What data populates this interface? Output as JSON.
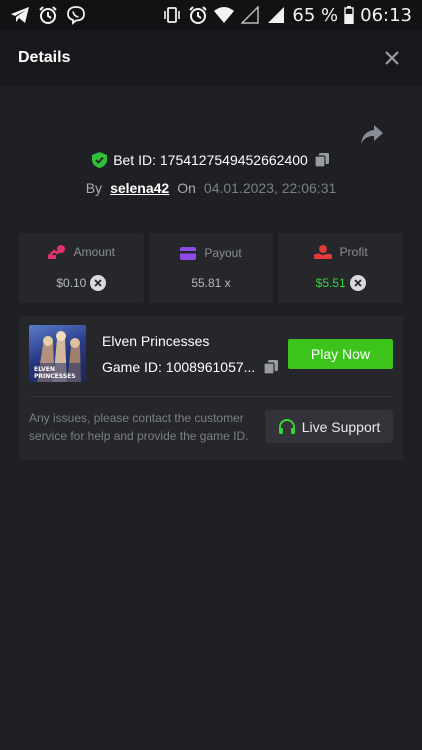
{
  "status_bar": {
    "battery": "65 %",
    "time": "06:13",
    "icons": [
      "telegram-icon",
      "alarm-icon",
      "viber-icon",
      "vibrate-icon",
      "alarm-icon",
      "wifi-icon",
      "signal-empty-icon",
      "signal-icon",
      "battery-icon"
    ]
  },
  "header": {
    "title": "Details"
  },
  "bet": {
    "id_label": "Bet ID: 1754127549452662400",
    "by_label": "By",
    "username": "selena42",
    "on_label": "On",
    "date": "04.01.2023, 22:06:31"
  },
  "stats": {
    "amount": {
      "label": "Amount",
      "value": "$0.10"
    },
    "payout": {
      "label": "Payout",
      "value": "55.81 x"
    },
    "profit": {
      "label": "Profit",
      "value": "$5.51"
    }
  },
  "game": {
    "title": "Elven Princesses",
    "game_id": "Game ID: 1008961057...",
    "thumbnail_text_top": "ELVEN",
    "thumbnail_text_mid": "PRINCESSES",
    "play_label": "Play Now",
    "issue_text": "Any issues, please contact the customer service for help and provide the game ID.",
    "support_label": "Live Support"
  },
  "colors": {
    "accent_green": "#3cc41c",
    "profit_green": "#39d23a",
    "shield_green": "#2fbf3a"
  }
}
